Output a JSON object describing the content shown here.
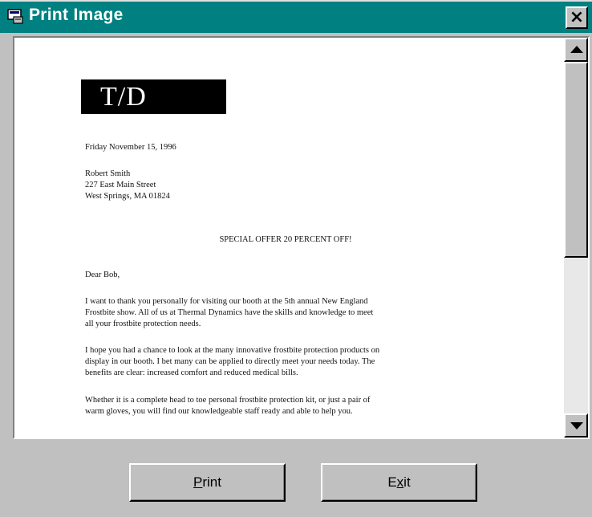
{
  "window": {
    "title": "Print Image",
    "close_label": "×"
  },
  "letter": {
    "logo_text": "T/D",
    "date": "Friday November 15, 1996",
    "address": [
      "Robert Smith",
      "227 East Main Street",
      "West Springs, MA 01824"
    ],
    "heading": "SPECIAL OFFER 20 PERCENT OFF!",
    "salutation": "Dear Bob,",
    "paragraphs": [
      [
        "I want to thank you personally for visiting our booth at the 5th annual New England",
        "Frostbite show.  All of us at Thermal Dynamics have the skills and knowledge to meet",
        "all your frostbite protection needs."
      ],
      [
        "I hope you had a chance to look at the many innovative frostbite protection products on",
        "display in our booth. I bet many can be applied to directly meet your needs today.  The",
        "benefits are clear: increased comfort and reduced medical bills."
      ],
      [
        "Whether it is a complete head to toe personal frostbite protection kit, or just a pair of",
        "warm gloves, you will find our knowledgeable staff ready and able to help you."
      ]
    ]
  },
  "buttons": {
    "print_first": "P",
    "print_rest": "rint",
    "exit_first": "E",
    "exit_mid": "x",
    "exit_rest": "it"
  },
  "scrollbar": {
    "position_fraction": 0.0
  },
  "colors": {
    "titlebar": "#008080",
    "face": "#c0c0c0"
  }
}
